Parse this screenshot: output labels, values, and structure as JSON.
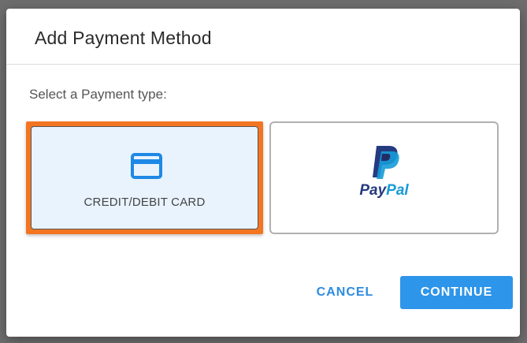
{
  "dialog": {
    "title": "Add Payment Method",
    "prompt": "Select a Payment type:",
    "options": [
      {
        "label": "CREDIT/DEBIT CARD",
        "icon": "credit-card-icon",
        "selected": true
      },
      {
        "label": "PayPal",
        "label_part_1": "Pay",
        "label_part_2": "Pal",
        "icon": "paypal-logo-icon",
        "selected": false
      }
    ],
    "cancel_label": "CANCEL",
    "continue_label": "CONTINUE"
  },
  "colors": {
    "accent": "#2d95ea",
    "link": "#2d8be0",
    "selection_highlight": "#f47521",
    "selected_fill": "#e8f3fd",
    "paypal_dark": "#253b80",
    "paypal_light": "#179bd7"
  }
}
